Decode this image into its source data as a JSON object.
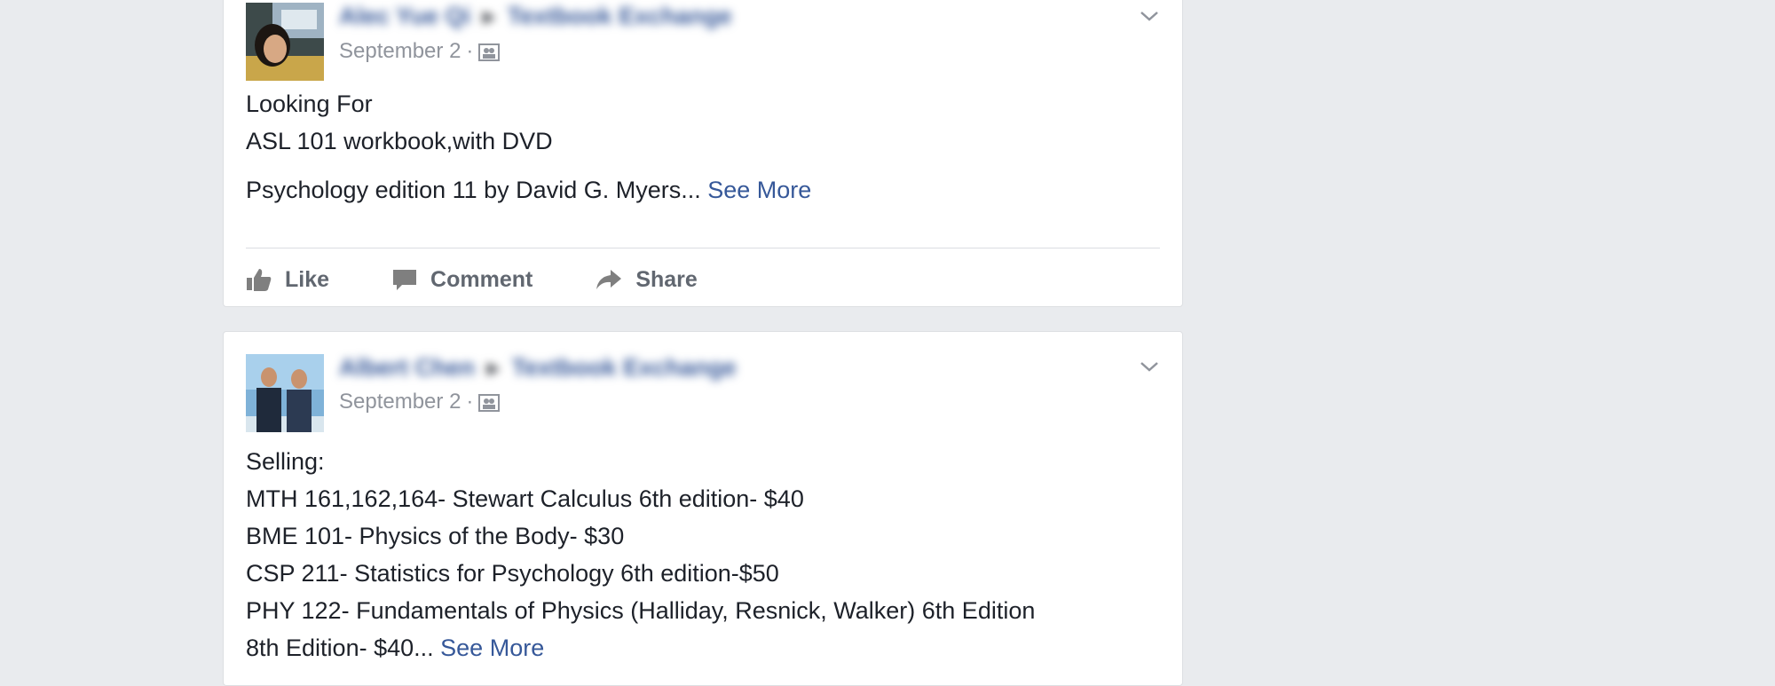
{
  "posts": [
    {
      "author": "Alec Yue Qi",
      "group": "Textbook Exchange",
      "date": "September 2",
      "separator": "·",
      "audience_icon": "group-icon",
      "lines": [
        "Looking For",
        "ASL 101 workbook,with DVD"
      ],
      "last_line": "Psychology edition 11 by David G. Myers...",
      "see_more": "See More",
      "actions": {
        "like": "Like",
        "comment": "Comment",
        "share": "Share"
      }
    },
    {
      "author": "Albert Chen",
      "group": "Textbook Exchange",
      "date": "September 2",
      "separator": "·",
      "audience_icon": "group-icon",
      "lines": [
        "Selling:",
        "MTH 161,162,164- Stewart Calculus 6th edition- $40",
        "BME 101- Physics of the Body- $30",
        "CSP 211- Statistics for Psychology 6th edition-$50",
        "PHY 122- Fundamentals of Physics (Halliday, Resnick, Walker) 6th Edition"
      ],
      "last_line": "8th Edition- $40...",
      "see_more": "See More"
    }
  ],
  "author_arrow": "▸",
  "colors": {
    "link": "#365899",
    "background": "#e9ebee",
    "meta": "#90949c"
  }
}
